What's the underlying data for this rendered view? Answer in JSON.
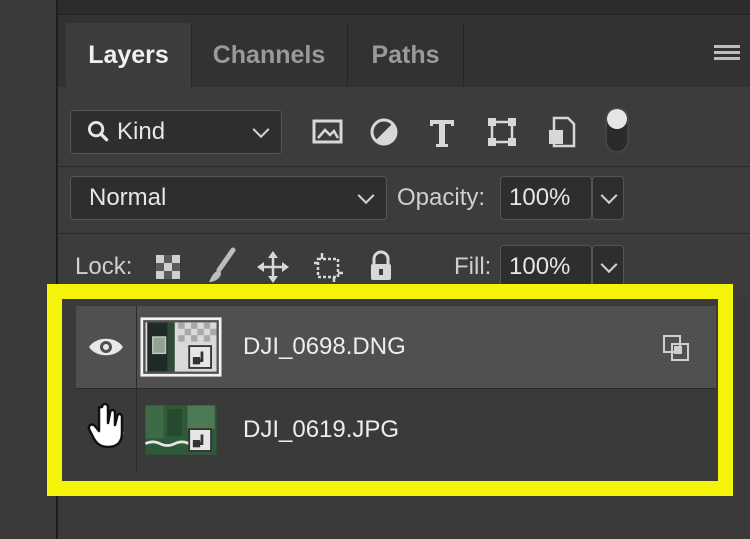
{
  "tabs": [
    {
      "label": "Layers",
      "active": true
    },
    {
      "label": "Channels",
      "active": false
    },
    {
      "label": "Paths",
      "active": false
    }
  ],
  "filter": {
    "kind_label": "Kind",
    "icons": [
      "image-filter-icon",
      "adjustment-filter-icon",
      "type-filter-icon",
      "shape-filter-icon",
      "smart-object-filter-icon",
      "filter-toggle-icon"
    ]
  },
  "blend": {
    "mode": "Normal",
    "opacity_label": "Opacity:",
    "opacity_value": "100%"
  },
  "lock": {
    "label": "Lock:",
    "fill_label": "Fill:",
    "fill_value": "100%"
  },
  "layers": [
    {
      "name": "DJI_0698.DNG",
      "visible": true,
      "selected": true,
      "smart_object": true
    },
    {
      "name": "DJI_0619.JPG",
      "visible": false,
      "selected": false,
      "smart_object": true
    }
  ],
  "colors": {
    "highlight": "#f5f20c",
    "panel": "#3c3c3c",
    "selected_row": "#505050"
  }
}
